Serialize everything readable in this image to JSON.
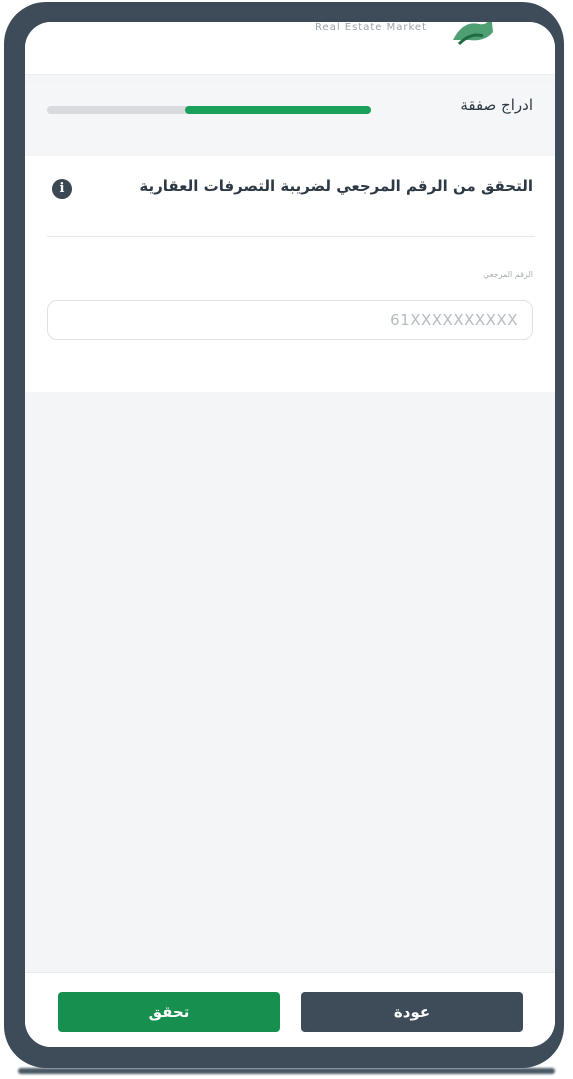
{
  "header": {
    "brand_subtitle": "Real Estate Market"
  },
  "progress": {
    "step_label": "ادراج صفقة",
    "fraction": 0.57
  },
  "form": {
    "title": "التحقق من الرقم المرجعي لضريبة التصرفات العقارية",
    "info_icon": "info-icon",
    "field_label": "الرقم المرجعي",
    "field_placeholder": "61XXXXXXXXXX",
    "field_value": ""
  },
  "actions": {
    "verify_label": "تحقق",
    "back_label": "عودة"
  },
  "colors": {
    "frame": "#3e4c59",
    "primary_green": "#168f4f",
    "progress_green": "#19a05a",
    "back_button": "#3e4c59"
  }
}
